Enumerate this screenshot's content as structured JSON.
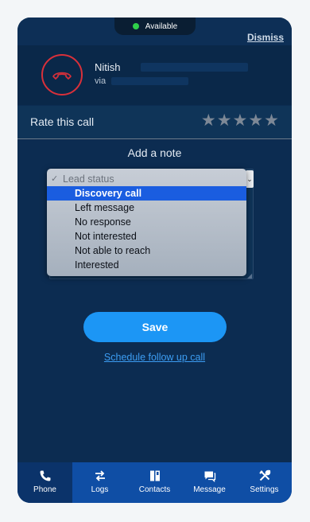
{
  "status": {
    "label": "Available",
    "dot_color": "#2fd04a"
  },
  "dismiss_label": "Dismiss",
  "caller": {
    "name": "Nitish",
    "via": "via"
  },
  "rating": {
    "label": "Rate this call",
    "stars": [
      "★",
      "★",
      "★",
      "★",
      "★"
    ],
    "value": 0
  },
  "note": {
    "heading": "Add a note"
  },
  "lead_status": {
    "placeholder": "Lead status",
    "selected": "Discovery call",
    "options": [
      "Discovery call",
      "Left message",
      "No response",
      "Not interested",
      "Not able to reach",
      "Interested"
    ]
  },
  "actions": {
    "save": "Save",
    "follow_up": "Schedule follow up call"
  },
  "tabs": [
    {
      "label": "Phone",
      "icon": "phone-icon",
      "active": true
    },
    {
      "label": "Logs",
      "icon": "swap-arrows-icon",
      "active": false
    },
    {
      "label": "Contacts",
      "icon": "contacts-book-icon",
      "active": false
    },
    {
      "label": "Message",
      "icon": "message-bubble-icon",
      "active": false
    },
    {
      "label": "Settings",
      "icon": "tools-icon",
      "active": false
    }
  ],
  "colors": {
    "background": "#0c2c51",
    "accent": "#1c96f5",
    "tabbar": "#0f4ea5",
    "end_call": "#d9303a"
  }
}
